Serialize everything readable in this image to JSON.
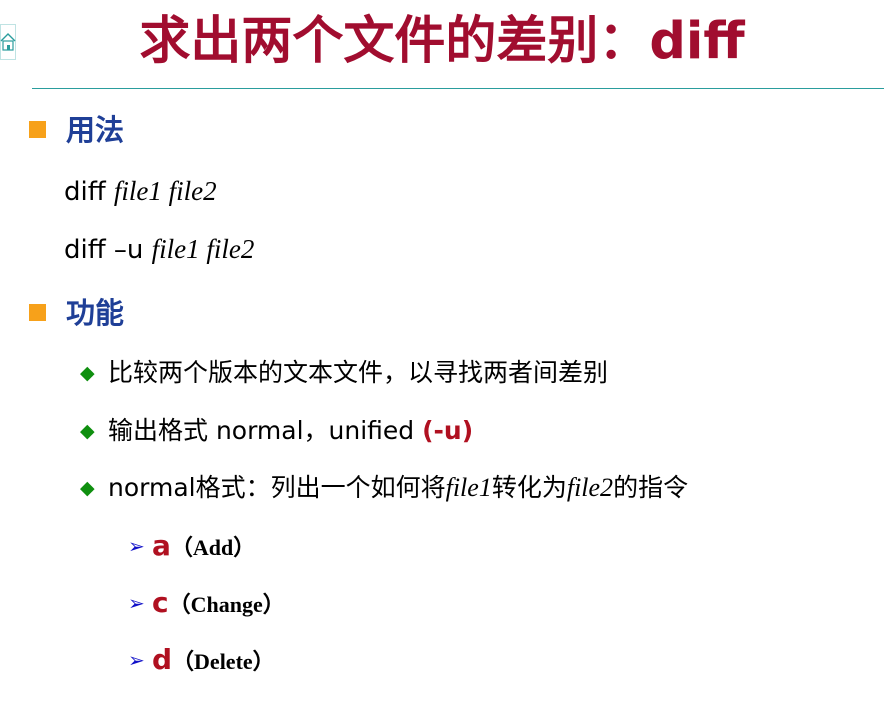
{
  "slide": {
    "title": "求出两个文件的差别：diff"
  },
  "usage": {
    "heading": "用法",
    "lines": [
      {
        "cmd": "diff ",
        "args": "file1 file2"
      },
      {
        "cmd": "diff –u ",
        "args": "file1 file2"
      }
    ]
  },
  "function": {
    "heading": "功能",
    "item1": "比较两个版本的文本文件，以寻找两者间差别",
    "item2": {
      "text": "输出格式 normal，unified ",
      "highlight": "(-u)"
    },
    "item3": {
      "prefix": "normal格式：列出一个如何将",
      "file1": "file1",
      "middle": "转化为",
      "file2": "file2",
      "suffix": "的指令"
    },
    "ops": [
      {
        "letter": "a",
        "name": "（Add）"
      },
      {
        "letter": "c",
        "name": "（Change）"
      },
      {
        "letter": "d",
        "name": "（Delete）"
      }
    ]
  },
  "colors": {
    "title": "#a10d2f",
    "heading": "#1f3f97",
    "square_bullet": "#f7a11a",
    "diamond_bullet": "#0f8f0f",
    "arrow_bullet": "#1010c8",
    "highlight": "#b01020",
    "rule": "#2a9d9d"
  },
  "icons": {
    "home": "home-icon",
    "square_bullet": "square-bullet-icon",
    "diamond_bullet": "diamond-bullet-icon",
    "arrow_bullet": "arrow-bullet-icon"
  }
}
